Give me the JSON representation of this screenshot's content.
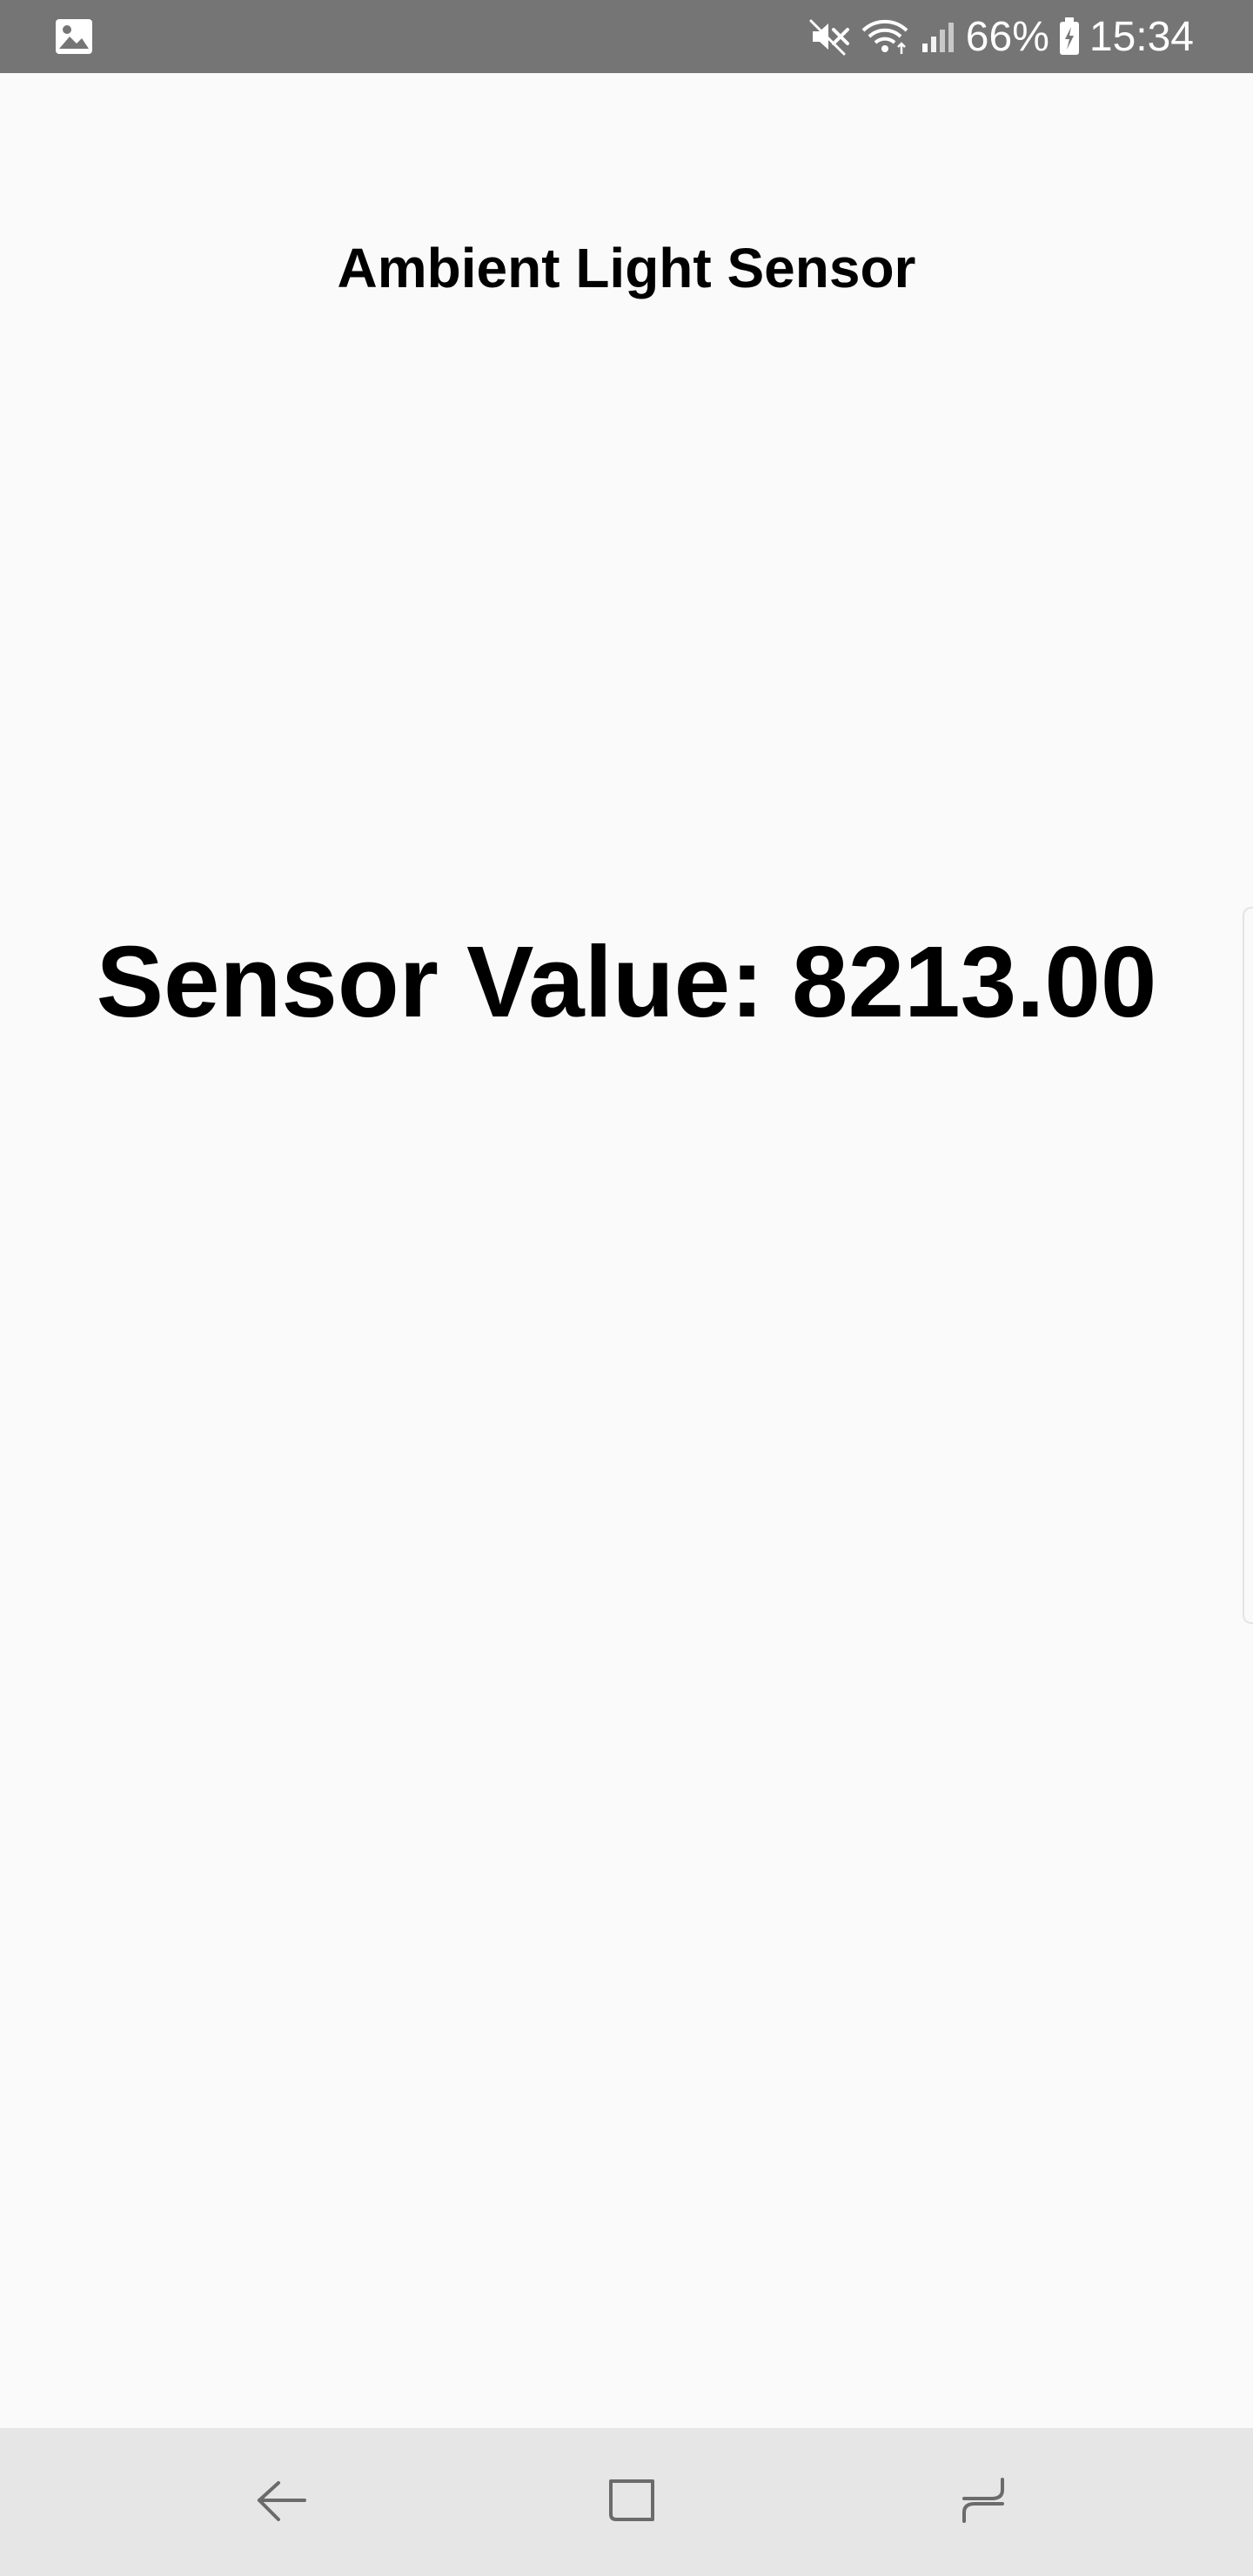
{
  "status_bar": {
    "left_icon": "image-notification-icon",
    "icons": [
      "mute-icon",
      "wifi-icon",
      "signal-icon",
      "battery-charging-icon"
    ],
    "battery_percent": "66%",
    "time": "15:34",
    "background_color": "#757575"
  },
  "app": {
    "title": "Ambient Light Sensor",
    "sensor_value_text": "Sensor Value: 8213.00",
    "background_color": "#fafafa"
  },
  "nav_bar": {
    "buttons": [
      "back-icon",
      "home-icon",
      "recents-icon"
    ],
    "background_color": "#e6e6e6"
  }
}
